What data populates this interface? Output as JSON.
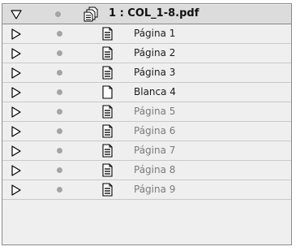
{
  "document": {
    "label": "1 : COL_1-8.pdf",
    "expanded": true,
    "icon": "pdf-document-icon"
  },
  "pages": [
    {
      "label": "Página 1",
      "icon": "page-icon",
      "dim": false
    },
    {
      "label": "Página 2",
      "icon": "page-icon",
      "dim": false
    },
    {
      "label": "Página 3",
      "icon": "page-icon",
      "dim": false
    },
    {
      "label": "Blanca 4",
      "icon": "blank-page-icon",
      "dim": false
    },
    {
      "label": "Página 5",
      "icon": "page-icon",
      "dim": true
    },
    {
      "label": "Página 6",
      "icon": "page-icon",
      "dim": true
    },
    {
      "label": "Página 7",
      "icon": "page-icon",
      "dim": true
    },
    {
      "label": "Página 8",
      "icon": "page-icon",
      "dim": true
    },
    {
      "label": "Página 9",
      "icon": "page-icon",
      "dim": true
    }
  ],
  "colors": {
    "panel_bg": "#efefef",
    "selected_row_bg": "#dcdcdc",
    "dim_text": "#7a7a7a",
    "dot": "#a4a4a4"
  }
}
